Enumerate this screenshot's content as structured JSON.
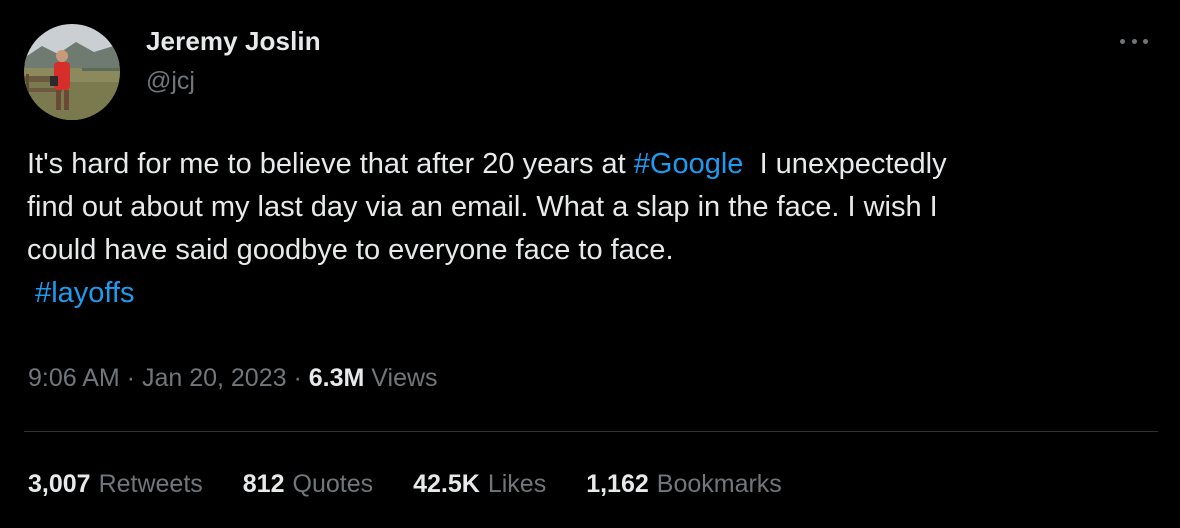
{
  "author": {
    "name": "Jeremy Joslin",
    "handle": "@jcj"
  },
  "tweet": {
    "text_1": "It's hard for me to believe that after 20 years at ",
    "hashtag_1": "#Google",
    "text_2": "  I unexpectedly\nfind out about my last day via an email. What a slap in the face. I wish I\ncould have said goodbye to everyone face to face.\n ",
    "hashtag_2": "#layoffs"
  },
  "meta": {
    "time": "9:06 AM",
    "separator_1": " · ",
    "date": "Jan 20, 2023",
    "separator_2": " · ",
    "views_count": "6.3M",
    "views_label": "Views"
  },
  "stats": [
    {
      "count": "3,007",
      "label": "Retweets"
    },
    {
      "count": "812",
      "label": "Quotes"
    },
    {
      "count": "42.5K",
      "label": "Likes"
    },
    {
      "count": "1,162",
      "label": "Bookmarks"
    }
  ],
  "icons": {
    "more": "more-icon"
  },
  "colors": {
    "background": "#000000",
    "text": "#e7e9ea",
    "secondary": "#71767b",
    "link": "#1d9bf0",
    "divider": "#2f3336"
  }
}
